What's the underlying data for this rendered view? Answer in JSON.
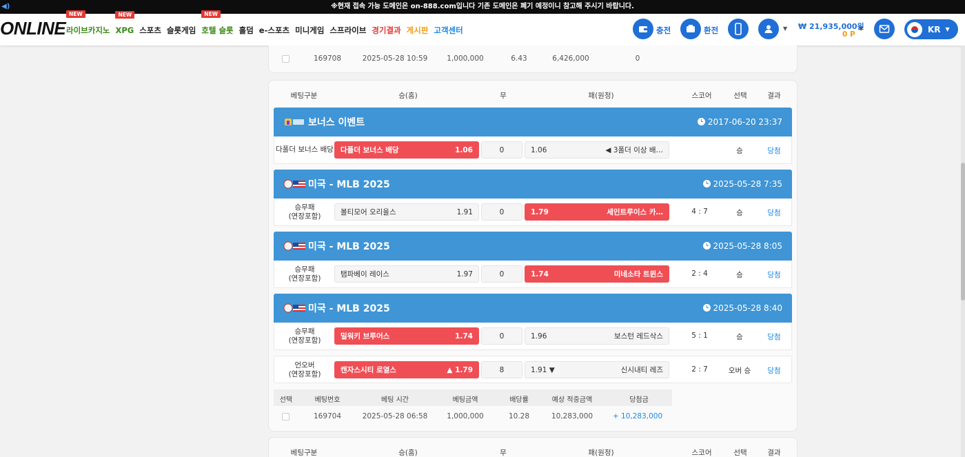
{
  "notice": "※현재 접속 가능 도메인은 on-888.com입니다 기존 도메인은 폐기 예정이니 참고해 주시기 바랍니다.",
  "logo": "ONLINE",
  "nav": [
    {
      "label": "라이브카지노",
      "new": "NEW",
      "color": "green"
    },
    {
      "label": "XPG",
      "new": "NEW",
      "color": "green"
    },
    {
      "label": "스포츠",
      "new": "",
      "color": "default"
    },
    {
      "label": "슬롯게임",
      "new": "",
      "color": "default"
    },
    {
      "label": "호텔 슬롯",
      "new": "NEW",
      "color": "green"
    },
    {
      "label": "홀덤",
      "new": "",
      "color": "default"
    },
    {
      "label": "e-스포츠",
      "new": "",
      "color": "default"
    },
    {
      "label": "미니게임",
      "new": "",
      "color": "default"
    },
    {
      "label": "스프라이브",
      "new": "",
      "color": "default"
    },
    {
      "label": "경기결과",
      "new": "",
      "color": "red"
    },
    {
      "label": "게시판",
      "new": "",
      "color": "orange"
    },
    {
      "label": "고객센터",
      "new": "",
      "color": "blue"
    }
  ],
  "header": {
    "deposit_label": "충전",
    "withdraw_label": "환전",
    "balance": "₩ 21,935,000원",
    "points": "0 P",
    "lang": "KR"
  },
  "colors": {
    "brand": "#1f6fd6",
    "league_bar": "#3f95d6",
    "selected": "#f04e55",
    "win": "#1e88e5"
  },
  "prev_bet": {
    "id": "169708",
    "time": "2025-05-28 10:59",
    "amount": "1,000,000",
    "odds": "6.43",
    "expected": "6,426,000",
    "win": "0"
  },
  "columns": {
    "type": "베팅구분",
    "home": "승(홈)",
    "draw": "무",
    "away": "패(원정)",
    "score": "스코어",
    "pick": "선택",
    "result": "결과"
  },
  "games": [
    {
      "league": "보너스 이벤트",
      "time": "2017-06-20 23:37",
      "flag": "bonus-icon",
      "rows": [
        {
          "label": "다폴더 보너스 배당",
          "home": "다폴더 보너스 배당",
          "home_odds": "1.06",
          "draw": "0",
          "away_odds": "1.06",
          "away": "◀ 3폴더 이상 배…",
          "score": "",
          "pick": "승",
          "result": "당첨",
          "selected": "home"
        }
      ]
    },
    {
      "league": "미국 - MLB 2025",
      "time": "2025-05-28 7:35",
      "flag": "baseball-usa-icon",
      "rows": [
        {
          "label": "승무패\n(연장포함)",
          "home": "볼티모어 오리올스",
          "home_odds": "1.91",
          "draw": "0",
          "away_odds": "1.79",
          "away": "세인트루이스 카…",
          "score": "4 : 7",
          "pick": "승",
          "result": "당첨",
          "selected": "away"
        }
      ]
    },
    {
      "league": "미국 - MLB 2025",
      "time": "2025-05-28 8:05",
      "flag": "baseball-usa-icon",
      "rows": [
        {
          "label": "승무패\n(연장포함)",
          "home": "탬파베이 레이스",
          "home_odds": "1.97",
          "draw": "0",
          "away_odds": "1.74",
          "away": "미네소타 트윈스",
          "score": "2 : 4",
          "pick": "승",
          "result": "당첨",
          "selected": "away"
        }
      ]
    },
    {
      "league": "미국 - MLB 2025",
      "time": "2025-05-28 8:40",
      "flag": "baseball-usa-icon",
      "rows": [
        {
          "label": "승무패\n(연장포함)",
          "home": "밀워키 브루어스",
          "home_odds": "1.74",
          "draw": "0",
          "away_odds": "1.96",
          "away": "보스턴 레드삭스",
          "score": "5 : 1",
          "pick": "승",
          "result": "당첨",
          "selected": "home"
        },
        {
          "label": "언오버\n(연장포함)",
          "home": "캔자스시티 로열스",
          "home_odds": "▲ 1.79",
          "draw": "8",
          "away_odds": "1.91 ▼",
          "away": "신시내티 레즈",
          "score": "2 : 7",
          "pick": "오버 승",
          "result": "당첨",
          "selected": "home"
        }
      ]
    }
  ],
  "detail": {
    "headers": [
      "선택",
      "베팅번호",
      "베팅 시간",
      "베팅금액",
      "배당률",
      "예상 적중금액",
      "당첨금"
    ],
    "row": {
      "id": "169704",
      "time": "2025-05-28 06:58",
      "amount": "1,000,000",
      "odds": "10.28",
      "expected": "10,283,000",
      "win": "+ 10,283,000"
    }
  }
}
